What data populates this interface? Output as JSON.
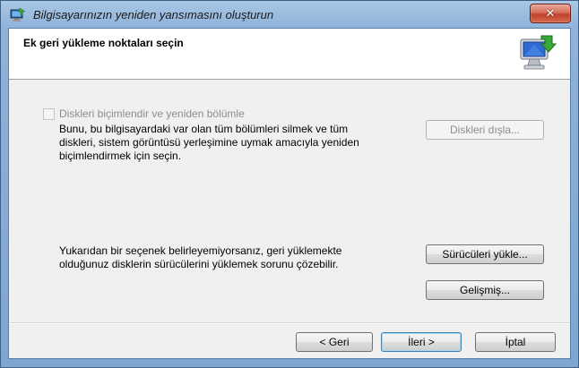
{
  "window": {
    "title": "Bilgisayarınızın yeniden yansımasını oluşturun",
    "close_glyph": "✕"
  },
  "header": {
    "title": "Ek geri yükleme noktaları seçin",
    "icon": "computer-restore-icon"
  },
  "format_option": {
    "checkbox_label": "Diskleri biçimlendir ve yeniden bölümle",
    "checked": false,
    "enabled": false,
    "description_lines": [
      "Bunu, bu bilgisayardaki var olan tüm bölümleri silmek ve tüm",
      "diskleri, sistem görüntüsü yerleşimine uymak amacıyla yeniden",
      "biçimlendirmek için seçin."
    ],
    "exclude_disks_label": "Diskleri dışla..."
  },
  "drivers": {
    "hint_lines": [
      "Yukarıdan bir seçenek belirleyemiyorsanız, geri yüklemekte",
      "olduğunuz disklerin sürücülerini yüklemek sorunu çözebilir."
    ],
    "install_drivers_label": "Sürücüleri yükle...",
    "advanced_label": "Gelişmiş..."
  },
  "footer": {
    "back_label": "< Geri",
    "next_label": "İleri >",
    "cancel_label": "İptal"
  },
  "colors": {
    "title_bar": "#8fb3d9",
    "close_button": "#c0412b",
    "dialog_background": "#f0f0f0",
    "disabled_text": "#8d8d8d"
  }
}
